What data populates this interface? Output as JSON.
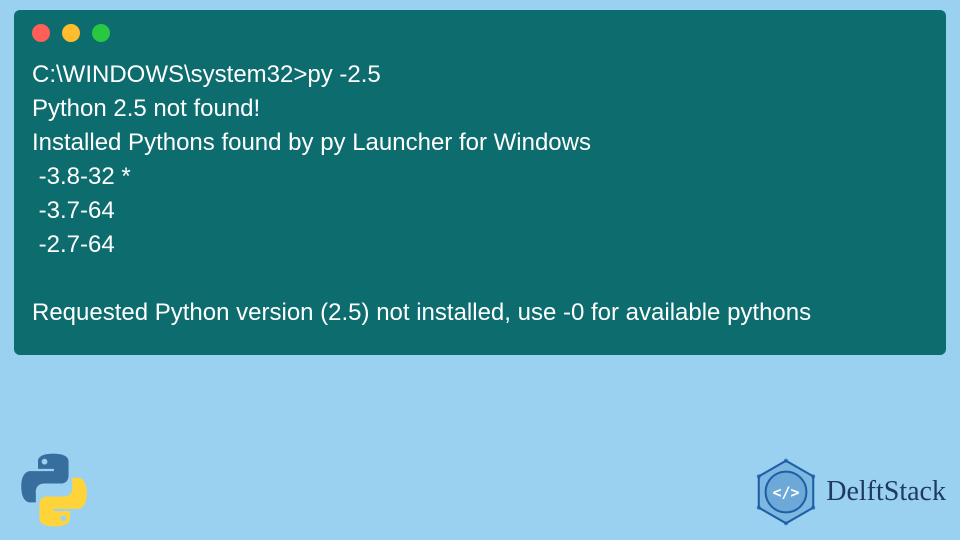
{
  "terminal": {
    "prompt": "C:\\WINDOWS\\system32>",
    "command": "py -2.5",
    "lines": {
      "not_found": "Python 2.5 not found!",
      "installed_header": "Installed Pythons found by py Launcher for Windows",
      "v1": " -3.8-32 *",
      "v2": " -3.7-64",
      "v3": " -2.7-64",
      "requested": "Requested Python version (2.5) not installed, use -0 for available pythons"
    }
  },
  "branding": {
    "name": "DelftStack"
  },
  "icons": {
    "python": "python-logo-icon",
    "delft": "delftstack-logo-icon"
  }
}
